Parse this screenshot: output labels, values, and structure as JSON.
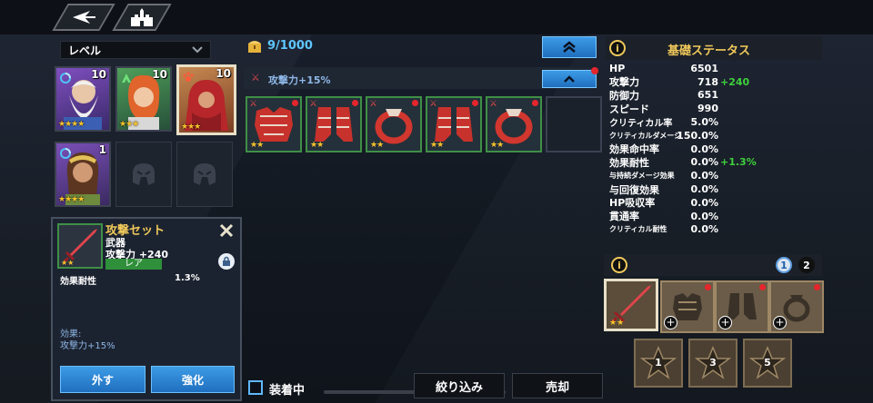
{
  "nav": {
    "back_icon": "back-arrow-icon",
    "home_icon": "castle-icon"
  },
  "left": {
    "dropdown_label": "レベル",
    "heroes": [
      {
        "level": "10",
        "stars": "★★★★",
        "element": "water"
      },
      {
        "level": "10",
        "stars": "★★★",
        "element": "wind"
      },
      {
        "level": "10",
        "stars": "★★★",
        "element": "fire"
      },
      {
        "level": "1",
        "stars": "★★★★",
        "element": "water"
      }
    ]
  },
  "popup": {
    "title": "攻撃セット",
    "type": "武器",
    "stat": "攻撃力 +240",
    "rarity": "レア",
    "sub_label": "効果耐性",
    "sub_value": "1.3%",
    "effect_label": "効果:",
    "effect_value": "攻撃力+15%",
    "remove_label": "外す",
    "enhance_label": "強化",
    "item_stars": "★★"
  },
  "center": {
    "capacity": "9/1000",
    "set_bonus": "攻撃力+15%",
    "items": [
      {
        "kind": "armor",
        "stars": "★★"
      },
      {
        "kind": "boots",
        "stars": "★★"
      },
      {
        "kind": "ring",
        "stars": "★★"
      },
      {
        "kind": "boots",
        "stars": "★★"
      },
      {
        "kind": "ring",
        "stars": "★★"
      }
    ],
    "equipped_label": "装着中",
    "filter_label": "絞り込み",
    "sell_label": "売却"
  },
  "right": {
    "title": "基礎ステータス",
    "stats": [
      {
        "label": "HP",
        "value": "6501",
        "bonus": ""
      },
      {
        "label": "攻撃力",
        "value": "718",
        "bonus": "+240"
      },
      {
        "label": "防御力",
        "value": "651",
        "bonus": ""
      },
      {
        "label": "スピード",
        "value": "990",
        "bonus": ""
      },
      {
        "label": "クリティカル率",
        "value": "5.0%",
        "bonus": ""
      },
      {
        "label": "クリティカルダメージ",
        "value": "150.0%",
        "bonus": ""
      },
      {
        "label": "効果命中率",
        "value": "0.0%",
        "bonus": ""
      },
      {
        "label": "効果耐性",
        "value": "0.0%",
        "bonus": "+1.3%"
      },
      {
        "label": "与持続ダメージ効果",
        "value": "0.0%",
        "bonus": ""
      },
      {
        "label": "与回復効果",
        "value": "0.0%",
        "bonus": ""
      },
      {
        "label": "HP吸収率",
        "value": "0.0%",
        "bonus": ""
      },
      {
        "label": "貫通率",
        "value": "0.0%",
        "bonus": ""
      },
      {
        "label": "クリティカル耐性",
        "value": "0.0%",
        "bonus": ""
      }
    ],
    "page1": "1",
    "page2": "2",
    "equip_stars": "★★",
    "star_levels": [
      "1",
      "3",
      "5"
    ]
  },
  "colors": {
    "accent_blue": "#2b8ee0",
    "gold": "#f0c95a",
    "green": "#3dd03b",
    "red_dot": "#e5262c"
  }
}
